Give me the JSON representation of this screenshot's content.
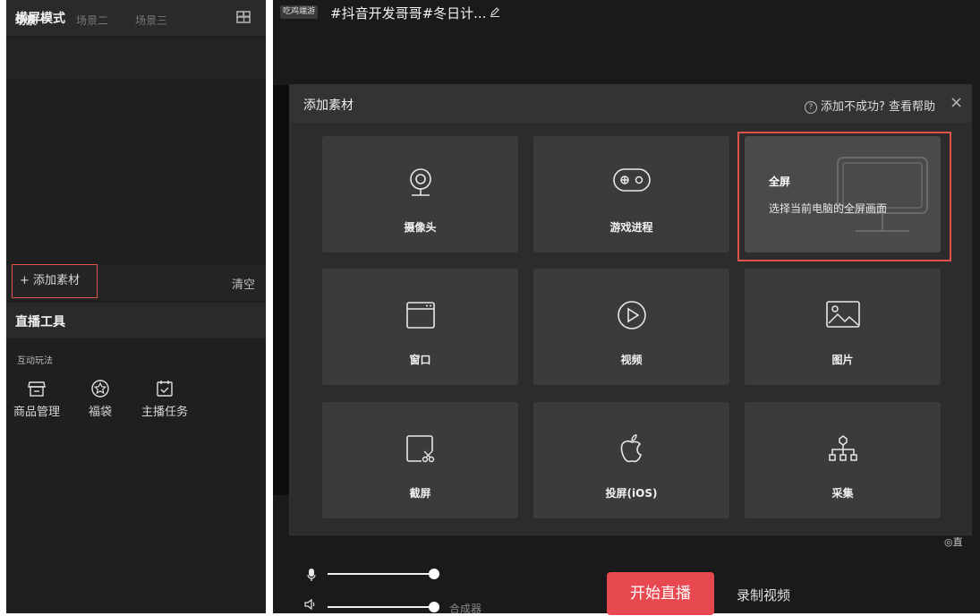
{
  "left_panel": {
    "title": "横屏模式",
    "scenes": [
      "场景一",
      "场景二",
      "场景三"
    ],
    "add_scene_icon": "+",
    "add_material": "+ 添加素材",
    "clear": "清空",
    "tools_title": "直播工具",
    "interact_label": "互动玩法",
    "tools": [
      {
        "label": "商品管理",
        "icon": "store-icon"
      },
      {
        "label": "福袋",
        "icon": "lucky-bag-icon"
      },
      {
        "label": "主播任务",
        "icon": "task-icon"
      }
    ]
  },
  "topbar": {
    "tag": "吃鸡端游",
    "title": "#抖音开发哥哥#冬日计..."
  },
  "modal": {
    "title": "添加素材",
    "help": "添加不成功? 查看帮助",
    "close": "×",
    "cards": [
      {
        "label": "摄像头",
        "icon": "camera-icon"
      },
      {
        "label": "游戏进程",
        "icon": "gamepad-icon"
      },
      {
        "label": "全屏",
        "desc": "选择当前电脑的全屏画面",
        "icon": "monitor-icon"
      },
      {
        "label": "窗口",
        "icon": "window-icon"
      },
      {
        "label": "视频",
        "icon": "play-icon"
      },
      {
        "label": "图片",
        "icon": "image-icon"
      },
      {
        "label": "截屏",
        "icon": "screenshot-icon"
      },
      {
        "label": "投屏(iOS)",
        "icon": "apple-icon"
      },
      {
        "label": "采集",
        "icon": "capture-icon"
      }
    ]
  },
  "bottom": {
    "mixer": "合成器",
    "start_live": "开始直播",
    "record": "录制视频",
    "side_hint": "◎直"
  },
  "colors": {
    "accent": "#e8484f",
    "highlight_border": "#e0524a",
    "panel_bg": "#1f1f1f"
  }
}
